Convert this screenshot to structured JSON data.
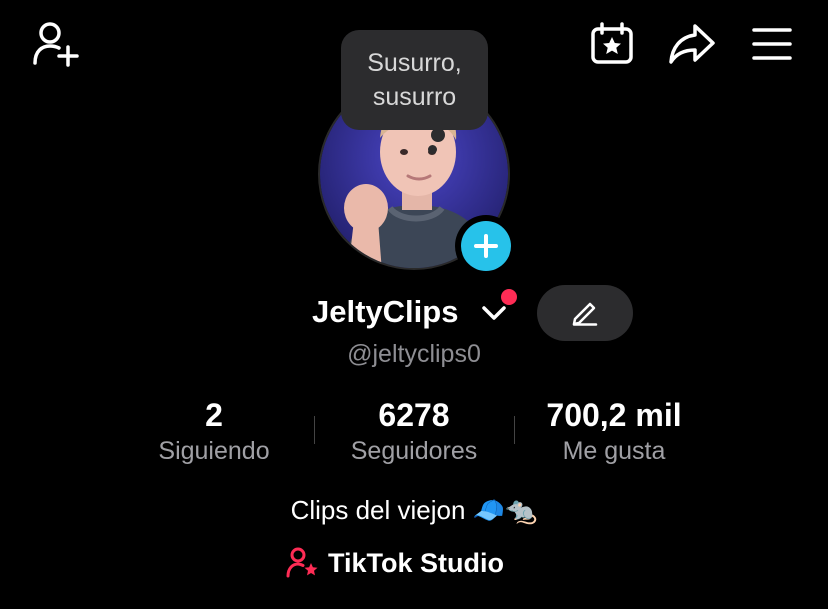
{
  "tooltip": {
    "text": "Susurro, susurro"
  },
  "profile": {
    "display_name": "JeltyClips",
    "handle": "@jeltyclips0",
    "bio": "Clips del viejon 🧢🐀"
  },
  "stats": [
    {
      "value": "2",
      "label": "Siguiendo"
    },
    {
      "value": "6278",
      "label": "Seguidores"
    },
    {
      "value": "700,2 mil",
      "label": "Me gusta"
    }
  ],
  "studio_link": {
    "label": "TikTok Studio"
  },
  "icons": {
    "top_left": "add-friend-icon",
    "top_right": [
      "calendar-star-icon",
      "share-icon",
      "menu-icon"
    ]
  },
  "colors": {
    "accent_cyan": "#27c2ea",
    "accent_red": "#fe2c55",
    "background": "#000000"
  }
}
